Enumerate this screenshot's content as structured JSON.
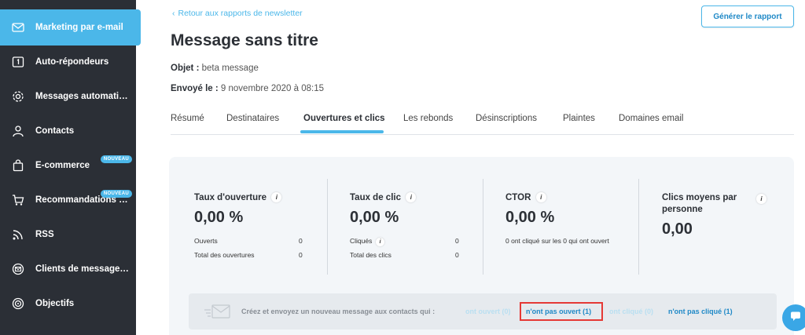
{
  "sidebar": {
    "items": [
      {
        "label": "Marketing par e-mail",
        "icon": "mail-icon",
        "active": true
      },
      {
        "label": "Auto-répondeurs",
        "icon": "autoresponder-icon"
      },
      {
        "label": "Messages automatisés",
        "icon": "gear-icon"
      },
      {
        "label": "Contacts",
        "icon": "person-icon"
      },
      {
        "label": "E-commerce",
        "icon": "shopping-bag-icon",
        "badge": "NOUVEAU"
      },
      {
        "label": "Recommandations de …",
        "icon": "cart-icon",
        "badge": "NOUVEAU"
      },
      {
        "label": "RSS",
        "icon": "rss-icon"
      },
      {
        "label": "Clients de messagerie",
        "icon": "mail-client-icon"
      },
      {
        "label": "Objectifs",
        "icon": "target-icon"
      }
    ]
  },
  "header": {
    "back_link": "Retour aux rapports de newsletter",
    "generate_button": "Générer le rapport",
    "title": "Message sans titre",
    "subject_label": "Objet :",
    "subject_value": "beta message",
    "sent_label": "Envoyé le :",
    "sent_value": "9 novembre 2020 à 08:15"
  },
  "tabs": [
    "Résumé",
    "Destinataires",
    "Ouvertures et clics",
    "Les rebonds",
    "Désinscriptions",
    "Plaintes",
    "Domaines email"
  ],
  "active_tab": "Ouvertures et clics",
  "stats": {
    "open_rate": {
      "title": "Taux d'ouverture",
      "value": "0,00 %",
      "rows": [
        {
          "label": "Ouverts",
          "value": "0"
        },
        {
          "label": "Total des ouvertures",
          "value": "0"
        }
      ]
    },
    "click_rate": {
      "title": "Taux de clic",
      "value": "0,00 %",
      "rows": [
        {
          "label": "Cliqués",
          "value": "0"
        },
        {
          "label": "Total des clics",
          "value": "0"
        }
      ]
    },
    "ctor": {
      "title": "CTOR",
      "value": "0,00 %",
      "note": "0 ont cliqué sur les 0 qui ont ouvert"
    },
    "avg_clicks": {
      "title": "Clics moyens par personne",
      "value": "0,00"
    }
  },
  "cta": {
    "text": "Créez et envoyez un nouveau message aux contacts qui :",
    "opened": "ont ouvert (0)",
    "not_opened": "n'ont pas ouvert (1)",
    "clicked": "ont cliqué (0)",
    "not_clicked": "n'ont pas cliqué (1)"
  },
  "colors": {
    "accent": "#4bb7e9",
    "sidebar_bg": "#2b2f36",
    "highlight_box": "#e53935"
  }
}
